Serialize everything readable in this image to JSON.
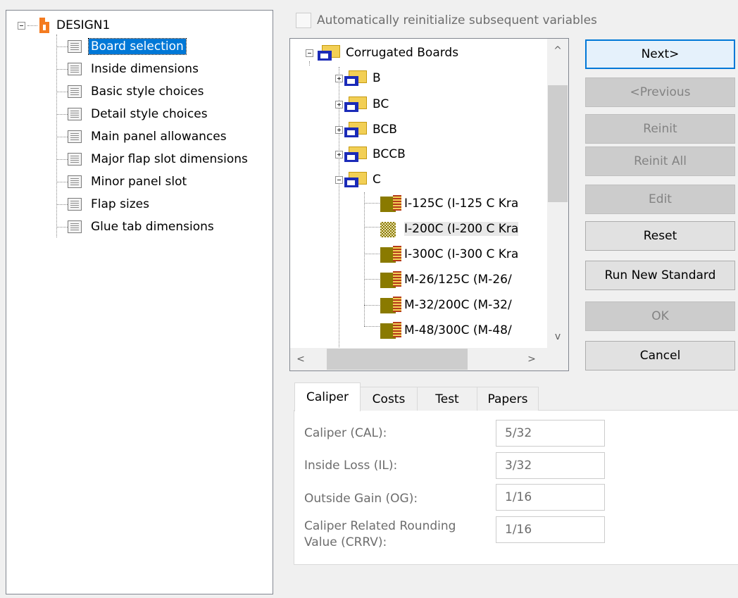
{
  "left_tree": {
    "root_label": "DESIGN1",
    "items": [
      {
        "label": "Board selection",
        "selected": true
      },
      {
        "label": "Inside dimensions"
      },
      {
        "label": "Basic style choices"
      },
      {
        "label": "Detail style choices"
      },
      {
        "label": "Main panel allowances"
      },
      {
        "label": "Major flap slot dimensions"
      },
      {
        "label": "Minor panel slot"
      },
      {
        "label": "Flap sizes"
      },
      {
        "label": "Glue tab dimensions"
      }
    ]
  },
  "auto_reinit_label": "Automatically reinitialize subsequent variables",
  "board_tree": {
    "root": "Corrugated Boards",
    "groups": [
      "B",
      "BC",
      "BCB",
      "BCCB",
      "C"
    ],
    "c_children": [
      "I-125C (I-125 C Kra",
      "I-200C (I-200 C Kra",
      "I-300C (I-300 C Kra",
      "M-26/125C (M-26/",
      "M-32/200C (M-32/",
      "M-48/300C (M-48/"
    ]
  },
  "scroll_glyphs": {
    "up": "^",
    "down": "v",
    "left": "<",
    "right": ">"
  },
  "buttons": {
    "next": "Next>",
    "previous": "<Previous",
    "reinit": "Reinit",
    "reinit_all": "Reinit All",
    "edit": "Edit",
    "reset": "Reset",
    "run_new_standard": "Run New Standard",
    "ok": "OK",
    "cancel": "Cancel"
  },
  "tabs": [
    "Caliper",
    "Costs",
    "Test",
    "Papers"
  ],
  "caliper_fields": [
    {
      "label": "Caliper (CAL):",
      "value": "5/32"
    },
    {
      "label": "Inside Loss (IL):",
      "value": "3/32"
    },
    {
      "label": "Outside Gain (OG):",
      "value": "1/16"
    },
    {
      "label": "Caliper Related Rounding Value (CRRV):",
      "value": "1/16"
    }
  ],
  "colors": {
    "accent": "#0078d7",
    "design_icon": "#f47b20"
  }
}
